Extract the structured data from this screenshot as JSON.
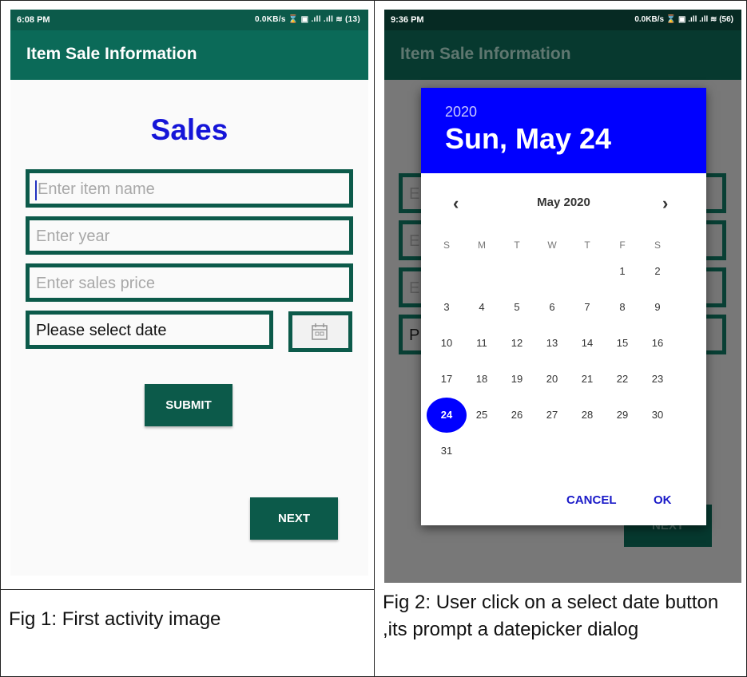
{
  "fig1": {
    "status_time": "6:08 PM",
    "status_right": "0.0KB/s ⌛ ▣ .ıll .ıll ≋ (13)",
    "app_title": "Item Sale Information",
    "heading": "Sales",
    "item_placeholder": "Enter item name",
    "year_placeholder": "Enter year",
    "price_placeholder": "Enter sales price",
    "date_text": "Please select date",
    "submit_label": "SUBMIT",
    "next_label": "NEXT",
    "caption": "Fig 1: First activity image",
    "calendar_icon": "calendar-icon"
  },
  "fig2": {
    "status_time": "9:36 PM",
    "status_right": "0.0KB/s ⌛ ▣ .ıll .ıll ≋ (56)",
    "app_title": "Item Sale Information",
    "bg_letter": "E",
    "bg_letter_p": "P",
    "bg_next": "NEXT",
    "dialog": {
      "year": "2020",
      "date": "Sun, May 24",
      "month": "May 2020",
      "prev": "‹",
      "next": "›",
      "weekdays": [
        "S",
        "M",
        "T",
        "W",
        "T",
        "F",
        "S"
      ],
      "days": [
        "1",
        "2",
        "3",
        "4",
        "5",
        "6",
        "7",
        "8",
        "9",
        "10",
        "11",
        "12",
        "13",
        "14",
        "15",
        "16",
        "17",
        "18",
        "19",
        "20",
        "21",
        "22",
        "23",
        "24",
        "25",
        "26",
        "27",
        "28",
        "29",
        "30",
        "31"
      ],
      "selected_day": "24",
      "cancel": "CANCEL",
      "ok": "OK"
    },
    "caption": "Fig 2: User click on a select date button ,its prompt a datepicker dialog"
  },
  "colors": {
    "primary": "#0b6a58",
    "accent": "#0000ff",
    "heading": "#1515d8"
  }
}
